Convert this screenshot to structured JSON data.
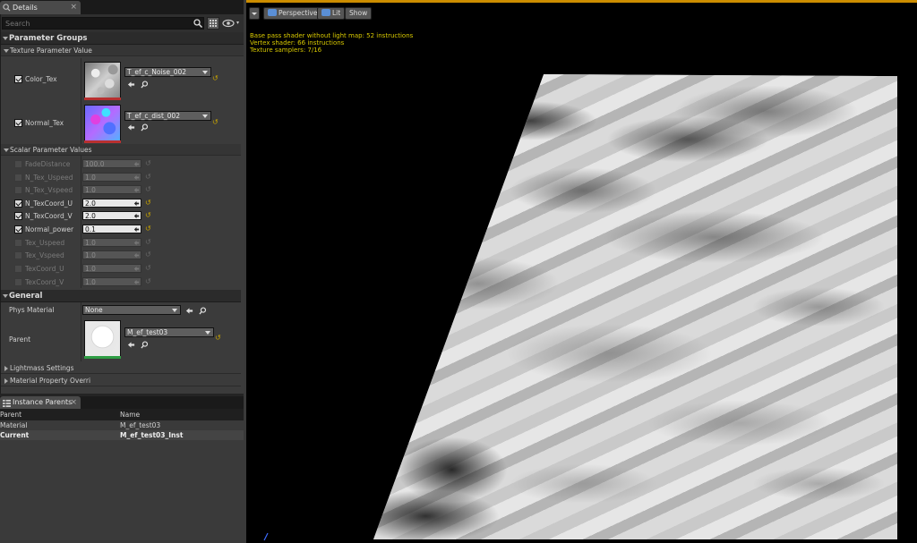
{
  "details": {
    "tab_title": "Details",
    "search_placeholder": "Search",
    "categories": {
      "parameter_groups": "Parameter Groups",
      "texture_params": "Texture Parameter Value",
      "scalar_params": "Scalar Parameter Values",
      "general": "General",
      "lightmass": "Lightmass Settings",
      "material_property": "Material Property Overri"
    },
    "textures": [
      {
        "label": "Color_Tex",
        "asset": "T_ef_c_Noise_002",
        "checked": true
      },
      {
        "label": "Normal_Tex",
        "asset": "T_ef_c_dist_002",
        "checked": true
      }
    ],
    "scalars": [
      {
        "label": "FadeDistance",
        "value": "100.0",
        "enabled": false
      },
      {
        "label": "N_Tex_Uspeed",
        "value": "1.0",
        "enabled": false
      },
      {
        "label": "N_Tex_Vspeed",
        "value": "1.0",
        "enabled": false
      },
      {
        "label": "N_TexCoord_U",
        "value": "2.0",
        "enabled": true
      },
      {
        "label": "N_TexCoord_V",
        "value": "2.0",
        "enabled": true
      },
      {
        "label": "Normal_power",
        "value": "0.1",
        "enabled": true
      },
      {
        "label": "Tex_Uspeed",
        "value": "1.0",
        "enabled": false
      },
      {
        "label": "Tex_Vspeed",
        "value": "1.0",
        "enabled": false
      },
      {
        "label": "TexCoord_U",
        "value": "1.0",
        "enabled": false
      },
      {
        "label": "TexCoord_V",
        "value": "1.0",
        "enabled": false
      }
    ],
    "general": {
      "phys_material_label": "Phys Material",
      "phys_material_value": "None",
      "parent_label": "Parent",
      "parent_value": "M_ef_test03"
    }
  },
  "instance_parents": {
    "tab_title": "Instance Parents",
    "col_parent": "Parent",
    "col_name": "Name",
    "rows": [
      {
        "parent": "Material",
        "name": "M_ef_test03",
        "current": false
      },
      {
        "parent": "Current",
        "name": "M_ef_test03_Inst",
        "current": true
      }
    ]
  },
  "viewport": {
    "buttons": {
      "perspective": "Perspective",
      "lit": "Lit",
      "show": "Show"
    },
    "stats": [
      "Base pass shader without light map: 52 instructions",
      "Vertex shader: 66 instructions",
      "Texture samplers: 7/16"
    ]
  },
  "colors": {
    "accent": "#cc8d00",
    "stat_text": "#d8c900",
    "reset_arrow": "#c8a400"
  }
}
